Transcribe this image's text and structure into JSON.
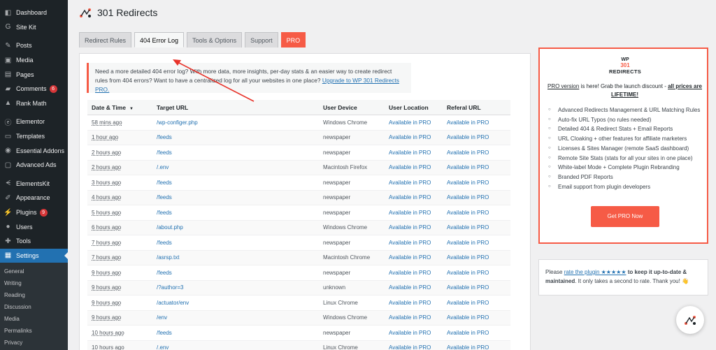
{
  "sidebar": {
    "items": [
      {
        "label": "Dashboard",
        "icon": "dashboard-icon",
        "glyph": "◧"
      },
      {
        "label": "Site Kit",
        "icon": "sitekit-icon",
        "glyph": "G"
      },
      {
        "label": "Posts",
        "icon": "pin-icon",
        "glyph": "✎"
      },
      {
        "label": "Media",
        "icon": "media-icon",
        "glyph": "▣"
      },
      {
        "label": "Pages",
        "icon": "page-icon",
        "glyph": "▤"
      },
      {
        "label": "Comments",
        "icon": "comment-icon",
        "glyph": "▰",
        "badge": "6"
      },
      {
        "label": "Rank Math",
        "icon": "rankmath-icon",
        "glyph": "▲"
      },
      {
        "label": "Elementor",
        "icon": "elementor-icon",
        "glyph": "ⓔ"
      },
      {
        "label": "Templates",
        "icon": "folder-icon",
        "glyph": "▭"
      },
      {
        "label": "Essential Addons",
        "icon": "essential-addons-icon",
        "glyph": "◉"
      },
      {
        "label": "Advanced Ads",
        "icon": "ads-icon",
        "glyph": "▢"
      },
      {
        "label": "ElementsKit",
        "icon": "elementskit-icon",
        "glyph": "ᗕ"
      },
      {
        "label": "Appearance",
        "icon": "brush-icon",
        "glyph": "✐"
      },
      {
        "label": "Plugins",
        "icon": "plugin-icon",
        "glyph": "⚡",
        "badge": "9"
      },
      {
        "label": "Users",
        "icon": "user-icon",
        "glyph": "●"
      },
      {
        "label": "Tools",
        "icon": "wrench-icon",
        "glyph": "✚"
      },
      {
        "label": "Settings",
        "icon": "settings-icon",
        "glyph": "▦"
      }
    ],
    "submenu": [
      "General",
      "Writing",
      "Reading",
      "Discussion",
      "Media",
      "Permalinks",
      "Privacy"
    ]
  },
  "header": {
    "title": "301 Redirects"
  },
  "tabs": [
    {
      "label": "Redirect Rules"
    },
    {
      "label": "404 Error Log"
    },
    {
      "label": "Tools & Options"
    },
    {
      "label": "Support"
    },
    {
      "label": "PRO"
    }
  ],
  "notice": {
    "text": "Need a more detailed 404 error log? With more data, more insights, per-day stats & an easier way to create redirect rules from 404 errors? Want to have a centralized log for all your websites in one place?",
    "link": "Upgrade to WP 301 Redirects PRO."
  },
  "table": {
    "headers": [
      "Date & Time",
      "Target URL",
      "User Device",
      "User Location",
      "Referal URL"
    ],
    "sort_indicator": "▼",
    "rows": [
      [
        "58 mins ago",
        "/wp-configer.php",
        "Windows Chrome",
        "Available in PRO",
        "Available in PRO"
      ],
      [
        "1 hour ago",
        "/feeds",
        "newspaper",
        "Available in PRO",
        "Available in PRO"
      ],
      [
        "2 hours ago",
        "/feeds",
        "newspaper",
        "Available in PRO",
        "Available in PRO"
      ],
      [
        "2 hours ago",
        "/.env",
        "Macintosh Firefox",
        "Available in PRO",
        "Available in PRO"
      ],
      [
        "3 hours ago",
        "/feeds",
        "newspaper",
        "Available in PRO",
        "Available in PRO"
      ],
      [
        "4 hours ago",
        "/feeds",
        "newspaper",
        "Available in PRO",
        "Available in PRO"
      ],
      [
        "5 hours ago",
        "/feeds",
        "newspaper",
        "Available in PRO",
        "Available in PRO"
      ],
      [
        "6 hours ago",
        "/about.php",
        "Windows Chrome",
        "Available in PRO",
        "Available in PRO"
      ],
      [
        "7 hours ago",
        "/feeds",
        "newspaper",
        "Available in PRO",
        "Available in PRO"
      ],
      [
        "7 hours ago",
        "/asrsp.txt",
        "Macintosh Chrome",
        "Available in PRO",
        "Available in PRO"
      ],
      [
        "9 hours ago",
        "/feeds",
        "newspaper",
        "Available in PRO",
        "Available in PRO"
      ],
      [
        "9 hours ago",
        "/?author=3",
        "unknown",
        "Available in PRO",
        "Available in PRO"
      ],
      [
        "9 hours ago",
        "/actuator/env",
        "Linux Chrome",
        "Available in PRO",
        "Available in PRO"
      ],
      [
        "9 hours ago",
        "/env",
        "Windows Chrome",
        "Available in PRO",
        "Available in PRO"
      ],
      [
        "10 hours ago",
        "/feeds",
        "newspaper",
        "Available in PRO",
        "Available in PRO"
      ],
      [
        "10 hours ago",
        "/.env",
        "Linux Chrome",
        "Available in PRO",
        "Available in PRO"
      ]
    ]
  },
  "promo": {
    "logo_wp": "WP",
    "logo_num": "301",
    "logo_redirects": "REDIRECTS",
    "head_link": "PRO version",
    "head_mid": " is here! Grab the launch discount - ",
    "head_bold": "all prices are LIFETIME!",
    "features": [
      "Advanced Redirects Management & URL Matching Rules",
      "Auto-fix URL Typos (no rules needed)",
      "Detailed 404 & Redirect Stats + Email Reports",
      "URL Cloaking + other features for affiliate marketers",
      "Licenses & Sites Manager (remote SaaS dashboard)",
      "Remote Site Stats (stats for all your sites in one place)",
      "White-label Mode + Complete Plugin Rebranding",
      "Branded PDF Reports",
      "Email support from plugin developers"
    ],
    "button": "Get PRO Now"
  },
  "rate": {
    "pre": "Please ",
    "link": "rate the plugin",
    "stars": "★★★★★",
    "bold": " to keep it up-to-date & maintained",
    "post": ". It only takes a second to rate. Thank you! 👋"
  },
  "colors": {
    "accent": "#f65b46",
    "wp_blue": "#2271b1",
    "sidebar_bg": "#1d2327"
  }
}
